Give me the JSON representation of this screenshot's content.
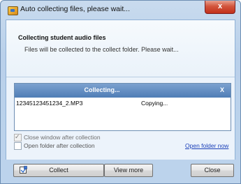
{
  "window": {
    "title": "Auto collecting files, please wait...",
    "close_label": "x"
  },
  "header": {
    "title": "Collecting student audio files",
    "description": "Files will be collected to the collect folder. Please wait..."
  },
  "collect_panel": {
    "title": "Collecting...",
    "close_label": "X",
    "files": [
      {
        "name": "12345123451234_2.MP3",
        "status": "Copying..."
      }
    ]
  },
  "options": {
    "close_after": {
      "label": "Close window after collection",
      "checked": true
    },
    "open_after": {
      "label": "Open folder after collection",
      "checked": false
    },
    "open_folder_link": "Open folder now"
  },
  "buttons": {
    "collect": "Collect",
    "view_more": "View more",
    "close": "Close"
  },
  "colors": {
    "title_bar": "#c9dbee",
    "close_button": "#c2301a",
    "panel_header": "#5b86bd",
    "link": "#1a3fb8"
  },
  "icons": {
    "app": "app-icon",
    "collect": "collect-icon"
  }
}
